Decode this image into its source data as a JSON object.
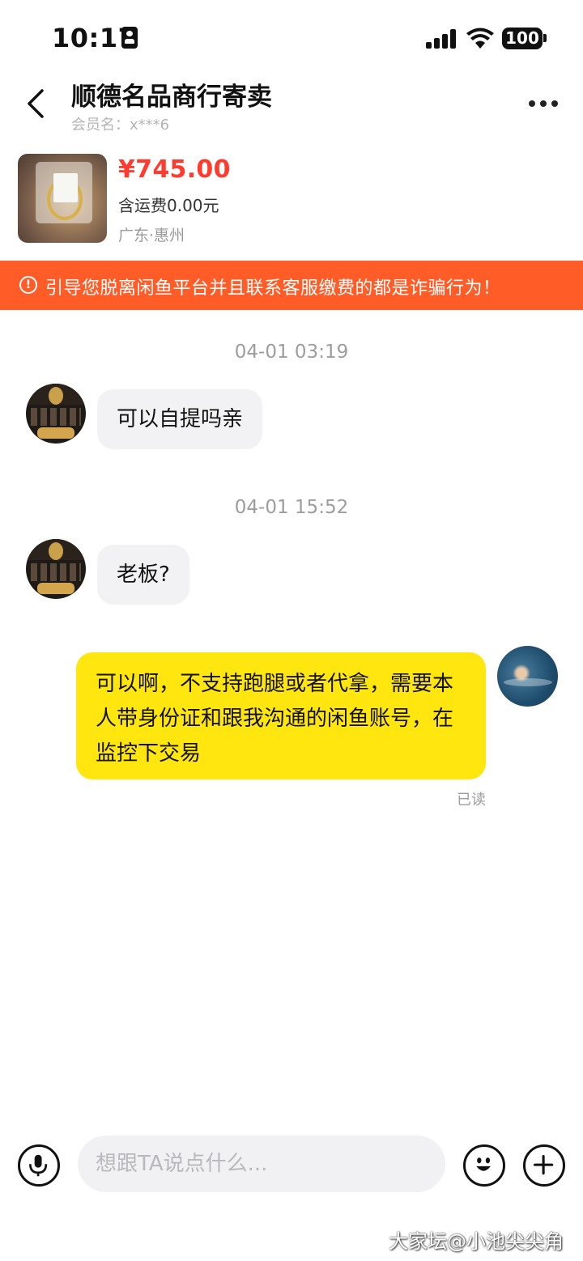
{
  "status_bar": {
    "time": "10:17",
    "battery": "100"
  },
  "header": {
    "title": "顺德名品商行寄卖",
    "member": "会员名：x***6"
  },
  "product": {
    "price": "¥745.00",
    "shipping": "含运费0.00元",
    "location": "广东·惠州"
  },
  "warning": {
    "icon": "!",
    "text": "引导您脱离闲鱼平台并且联系客服缴费的都是诈骗行为！"
  },
  "messages": [
    {
      "timestamp": "04-01 03:19",
      "text": "可以自提吗亲",
      "sender": "seller"
    },
    {
      "timestamp": "04-01 15:52",
      "text": "老板?",
      "sender": "seller"
    },
    {
      "text": "可以啊，不支持跑腿或者代拿，需要本人带身份证和跟我沟通的闲鱼账号，在监控下交易",
      "sender": "me",
      "status": "已读"
    }
  ],
  "input": {
    "placeholder": "想跟TA说点什么..."
  },
  "watermark": "大家坛@小池尖尖角",
  "colors": {
    "accent_yellow": "#ffe60f",
    "warning_orange": "#ff5c28",
    "price_red": "#ff3b30"
  }
}
